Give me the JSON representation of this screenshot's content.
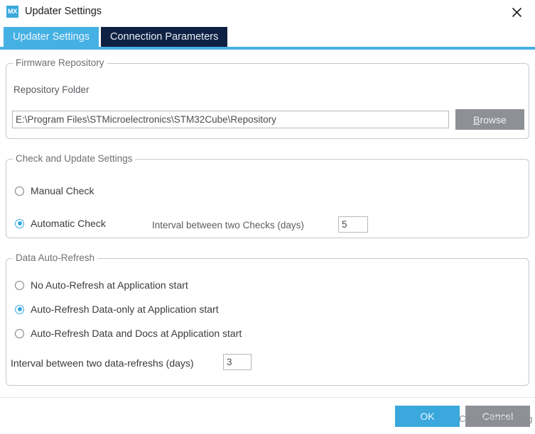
{
  "window": {
    "icon_text": "MX",
    "icon_name": "mx-app-icon",
    "title": "Updater Settings",
    "close_icon": "close-icon"
  },
  "tabs": [
    {
      "label": "Updater Settings",
      "active": true
    },
    {
      "label": "Connection Parameters",
      "active": false
    }
  ],
  "firmware_repository": {
    "group_title": "Firmware Repository",
    "folder_label": "Repository Folder",
    "folder_value": "E:\\Program Files\\STMicroelectronics\\STM32Cube\\Repository",
    "browse_label": "Browse",
    "browse_mnemonic": "B",
    "browse_rest": "rowse"
  },
  "check_update": {
    "group_title": "Check and Update Settings",
    "options": [
      {
        "label": "Manual Check",
        "checked": false
      },
      {
        "label": "Automatic Check",
        "checked": true
      }
    ],
    "interval_label": "Interval between two Checks (days)",
    "interval_value": "5"
  },
  "data_refresh": {
    "group_title": "Data Auto-Refresh",
    "options": [
      {
        "label": "No Auto-Refresh at Application start",
        "checked": false
      },
      {
        "label": "Auto-Refresh Data-only at Application start",
        "checked": true
      },
      {
        "label": "Auto-Refresh Data and Docs at Application start",
        "checked": false
      }
    ],
    "interval_label": "Interval between two data-refreshs (days)",
    "interval_value": "3"
  },
  "footer": {
    "ok_label": "OK",
    "cancel_label": "Cancel"
  },
  "watermark": {
    "text": "CSDN @ge2ming"
  },
  "colors": {
    "accent_blue": "#45b0e3",
    "tab_inactive": "#0f2143",
    "ok_blue": "#3aa8dc",
    "button_gray": "#8d9196",
    "radio_checked": "#36a9df",
    "group_border": "#c8c8c8"
  }
}
